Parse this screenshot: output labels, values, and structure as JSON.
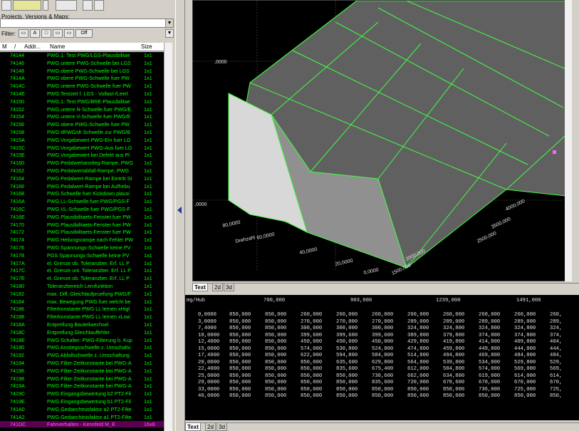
{
  "left": {
    "combo_label": "Projects, Versions & Maps:",
    "filter_label": "Filter:",
    "filter_off": "Off",
    "columns": [
      "M",
      "/",
      "Addr...",
      "Name",
      "Size"
    ],
    "rows": [
      [
        "74144",
        "PWG 1: Test PWG/LGS-Plausibilitae",
        "1x1"
      ],
      [
        "74146",
        "PWG untere PWG-Schwelle bei LGS",
        "1x1"
      ],
      [
        "74148",
        "PWG obere PWG-Schwelle bei LGS",
        "1x1"
      ],
      [
        "7414A",
        "PWG obere PWG-Schwelle fuer PW",
        "1x1"
      ],
      [
        "7414C",
        "PWG untere PWG-Schwelle fuer PW",
        "1x1"
      ],
      [
        "7414E",
        "PWG Testzeit f. LGS - Vollast-/Leerl",
        "1x1"
      ],
      [
        "74150",
        "PWG 1: Test PWG/BRE-Plausibilitae",
        "1x1"
      ],
      [
        "74152",
        "PWG untere N-Schwelle fuer PWG/E",
        "1x1"
      ],
      [
        "74154",
        "PWG untere V-Schwelle fuer PWG/E",
        "1x1"
      ],
      [
        "74156",
        "PWG obere PWG-Schwelle fuer PW",
        "1x1"
      ],
      [
        "74158",
        "PWG dPWG/dt Schwelle zur PWG/B",
        "1x1"
      ],
      [
        "7415A",
        "PWG Vorgabewert PWG-Ein fuer LG",
        "1x1"
      ],
      [
        "7415C",
        "PWG Vorgabewert PWG-Aus fuer LG",
        "1x1"
      ],
      [
        "7415E",
        "PWG Vorgabewert bei Defekt aus Pl",
        "1x1"
      ],
      [
        "74160",
        "PWG Pedalwertanstieg-Rampe, PWG",
        "1x1"
      ],
      [
        "74162",
        "PWG Pedalwertabfall-Rampe, PWG",
        "1x1"
      ],
      [
        "74164",
        "PWG Pedalwert-Rampe bei Eintritt St",
        "1x1"
      ],
      [
        "74166",
        "PWG Pedalwert-Rampe bei Aufhebu",
        "1x1"
      ],
      [
        "74168",
        "PWG Schwelle fuer Kickdown plausi",
        "1x1"
      ],
      [
        "7416A",
        "PWG LL-Schwelle fuer PWG/PGS-F",
        "1x1"
      ],
      [
        "7416C",
        "PWG VL-Schwelle fuer PWG/PGS-F",
        "1x1"
      ],
      [
        "7416E",
        "PWG Plausibilitaets-Fenster fuer PW",
        "1x1"
      ],
      [
        "74170",
        "PWG Plausibilitaets-Fenster fuer PW",
        "1x1"
      ],
      [
        "74172",
        "PWG Plausibilitaets-Fenster fuer PW",
        "1x1"
      ],
      [
        "74174",
        "PWG Heilungsrampe nach Fehler PW",
        "1x1"
      ],
      [
        "74176",
        "PWG Spannungs-Schwelle keine PV",
        "1x1"
      ],
      [
        "74178",
        "PGS Spannungs-Schwelle keine PV",
        "1x1"
      ],
      [
        "7417A",
        "el. Grenze ob. Toleranzber. Erf. LL P",
        "1x1"
      ],
      [
        "7417C",
        "el. Grenze unt. Toleranzber. Erf. LL P",
        "1x1"
      ],
      [
        "7417E",
        "el. Grenze ob. Toleranzber. Erf. LL P",
        "1x1"
      ],
      [
        "74180",
        "Toleranzbereich Lernfunktion",
        "1x1"
      ],
      [
        "74182",
        "max. Diff. Gleichlaufpruefung PWG/F",
        "1x1"
      ],
      [
        "74184",
        "max. Bewegung PWG fuer welcht be",
        "1x1"
      ],
      [
        "74186",
        "Filterkonstante PWG LL lernen xHigl",
        "1x1"
      ],
      [
        "74188",
        "Filterkonstante PWG LL lernen xLow",
        "1x1"
      ],
      [
        "7418A",
        "Entprellung Bauteilwechsel",
        "1x1"
      ],
      [
        "7418C",
        "Entprellung Gleichlauffehler",
        "1x1"
      ],
      [
        "7418E",
        "PWG Schalter: PWG-Filterung b. Kup",
        "1x1"
      ],
      [
        "74190",
        "PWG Anstiegsschwelle z. Umschaltu",
        "1x1"
      ],
      [
        "74192",
        "PWG Abfallschwelle z. Umschaltung",
        "1x1"
      ],
      [
        "74194",
        "PWG Filter-Zeitkonstante bei PWG-A",
        "1x1"
      ],
      [
        "74196",
        "PWG Filter-Zeitkonstante bei PWG-A",
        "1x1"
      ],
      [
        "74198",
        "PWG Filter-Zeitkonstante bei PWG-A",
        "1x1"
      ],
      [
        "7419A",
        "PWG Filter-Zeitkonstante bei PWG-A",
        "1x1"
      ],
      [
        "7419C",
        "PWG Eingangsbewertung b2 PT2-Fil",
        "1x1"
      ],
      [
        "7419E",
        "PWG Eingangsbewertung b1 PT2-Fil",
        "1x1"
      ],
      [
        "741A0",
        "PWG Gedaechtnisfaktor a2 PT2-Filte",
        "1x1"
      ],
      [
        "741A2",
        "PWG Gedaechtnisfaktor a1 PT2-Filte",
        "1x1"
      ],
      [
        "741DC",
        "Fahrverhalten - Kennfeld M_E",
        "16x8"
      ]
    ]
  },
  "graph": {
    "y_label_a": ",0000",
    "y_label_b": ",0000",
    "x_labels": [
      "80,0000",
      "60,0000",
      "40,0000",
      "20,0000",
      "0,0000"
    ],
    "x_axis_label": "Drehzahl",
    "right_labels": [
      "4000,000",
      "3500,000",
      "2500,000",
      "2000,000",
      "1500,000"
    ]
  },
  "graph_tabs": [
    "Text",
    "2d",
    "3d"
  ],
  "table_tabs": [
    "Text",
    "2d",
    "3d"
  ],
  "table": {
    "unit": "mg/Hub",
    "col_heads": [
      "700,000",
      "903,000",
      "1239,000",
      "1491,000"
    ],
    "rows": [
      [
        "0,0000",
        "850,000",
        "850,000",
        "260,000",
        "260,000",
        "260,000",
        "260,000",
        "260,000",
        "260,000",
        "260,000",
        "260,"
      ],
      [
        "3,0000",
        "850,000",
        "850,000",
        "270,000",
        "270,000",
        "270,000",
        "289,000",
        "289,000",
        "289,000",
        "289,000",
        "289,"
      ],
      [
        "7,4000",
        "850,000",
        "850,000",
        "300,000",
        "300,000",
        "300,000",
        "324,800",
        "324,800",
        "324,800",
        "324,800",
        "324,"
      ],
      [
        "10,0000",
        "850,000",
        "850,000",
        "399,600",
        "399,600",
        "399,600",
        "389,800",
        "379,800",
        "374,800",
        "374,800",
        "374,"
      ],
      [
        "12,4000",
        "850,000",
        "850,000",
        "450,000",
        "450,000",
        "450,000",
        "429,800",
        "419,800",
        "414,800",
        "409,800",
        "404,"
      ],
      [
        "15,0000",
        "850,000",
        "850,000",
        "574,000",
        "530,800",
        "524,800",
        "474,800",
        "459,800",
        "449,800",
        "444,800",
        "444,"
      ],
      [
        "17,4000",
        "850,000",
        "850,000",
        "622,000",
        "594,800",
        "584,800",
        "514,800",
        "494,800",
        "469,800",
        "484,800",
        "484,"
      ],
      [
        "20,0000",
        "850,000",
        "850,000",
        "850,000",
        "635,600",
        "629,800",
        "564,800",
        "539,800",
        "534,800",
        "529,800",
        "529,"
      ],
      [
        "22,4000",
        "850,000",
        "850,000",
        "850,000",
        "835,600",
        "675,400",
        "612,000",
        "584,800",
        "574,000",
        "569,000",
        "569,"
      ],
      [
        "25,0000",
        "850,000",
        "850,000",
        "850,000",
        "850,000",
        "730,600",
        "662,000",
        "634,800",
        "619,000",
        "614,000",
        "614,"
      ],
      [
        "29,0000",
        "850,000",
        "850,000",
        "850,000",
        "850,000",
        "835,600",
        "720,000",
        "678,600",
        "670,000",
        "670,000",
        "670,"
      ],
      [
        "33,0000",
        "850,000",
        "850,000",
        "850,000",
        "850,000",
        "850,000",
        "850,000",
        "850,000",
        "736,000",
        "725,000",
        "725,"
      ],
      [
        "40,0000",
        "850,000",
        "850,000",
        "850,000",
        "850,000",
        "850,000",
        "850,000",
        "850,000",
        "850,000",
        "850,000",
        "850,"
      ]
    ]
  }
}
